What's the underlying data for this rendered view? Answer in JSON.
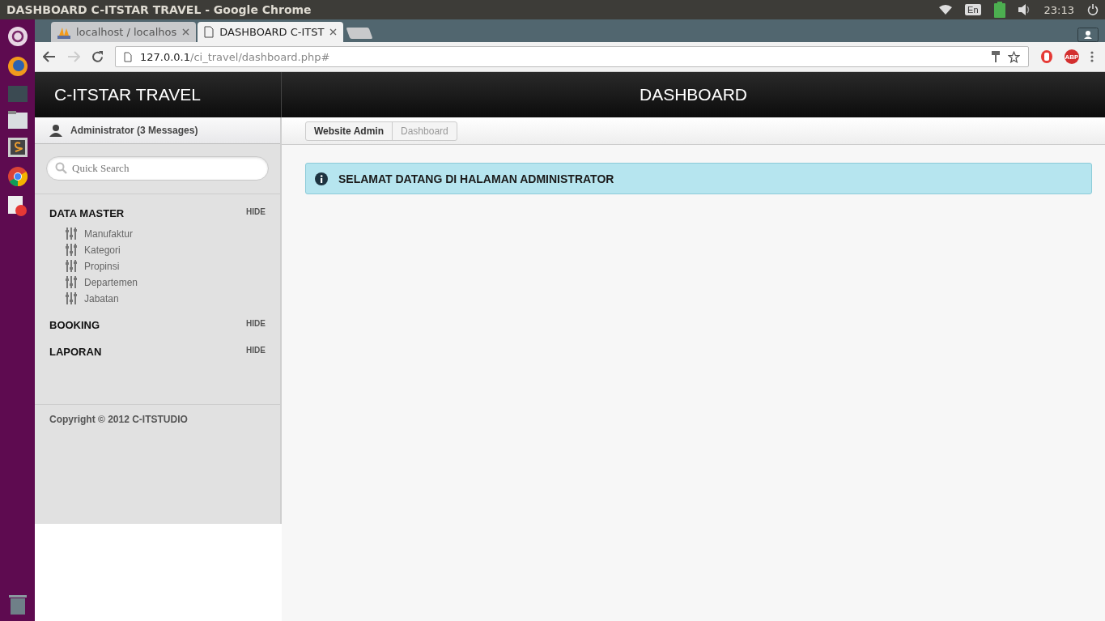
{
  "system_bar": {
    "window_title": "DASHBOARD C-ITSTAR TRAVEL - Google Chrome",
    "keyboard_layout": "En",
    "clock": "23:13"
  },
  "browser": {
    "tabs": [
      {
        "title": "localhost / localhos",
        "selected": false
      },
      {
        "title": "DASHBOARD C-ITST",
        "selected": true
      }
    ],
    "address": {
      "host": "127.0.0.1",
      "path": "/ci_travel/dashboard.php#"
    },
    "adblock_label": "ABP"
  },
  "header": {
    "brand": "C-ITSTAR TRAVEL",
    "page_title": "DASHBOARD"
  },
  "user": {
    "label": "Administrator (3 Messages)"
  },
  "breadcrumb": [
    {
      "label": "Website Admin",
      "selected": false
    },
    {
      "label": "Dashboard",
      "selected": true
    }
  ],
  "search": {
    "placeholder": "Quick Search"
  },
  "sidebar": {
    "sections": [
      {
        "title": "DATA MASTER",
        "toggle": "HIDE",
        "children": [
          {
            "label": "Manufaktur"
          },
          {
            "label": "Kategori"
          },
          {
            "label": "Propinsi"
          },
          {
            "label": "Departemen"
          },
          {
            "label": "Jabatan"
          }
        ]
      },
      {
        "title": "BOOKING",
        "toggle": "HIDE"
      },
      {
        "title": "LAPORAN",
        "toggle": "HIDE"
      }
    ],
    "footer": "Copyright © 2012 C-ITSTUDIO"
  },
  "alert": {
    "kind": "info",
    "text": "SELAMAT DATANG DI HALAMAN ADMINISTRATOR"
  }
}
